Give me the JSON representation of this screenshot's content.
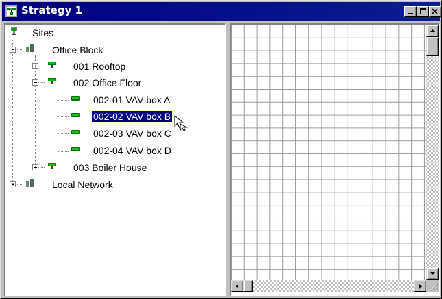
{
  "window": {
    "title": "Strategy 1",
    "icon": "strategy-window-icon",
    "controls": [
      "minimize-icon",
      "maximize-icon",
      "close-icon"
    ]
  },
  "tree": {
    "root": {
      "label": "Sites",
      "icon": "sites-icon"
    },
    "office_block": {
      "label": "Office Block",
      "icon": "site-building-icon",
      "expanded": true
    },
    "rooftop": {
      "label": "001 Rooftop",
      "icon": "device-icon",
      "expanded": false
    },
    "office_floor": {
      "label": "002 Office Floor",
      "icon": "device-icon",
      "expanded": true
    },
    "vav_a": {
      "label": "002-01 VAV box A",
      "icon": "vav-module-icon"
    },
    "vav_b": {
      "label": "002-02 VAV box B",
      "icon": "vav-module-icon",
      "selected": true
    },
    "vav_c": {
      "label": "002-03 VAV box C",
      "icon": "vav-module-icon"
    },
    "vav_d": {
      "label": "002-04 VAV box D",
      "icon": "vav-module-icon"
    },
    "boiler_house": {
      "label": "003 Boiler House",
      "icon": "device-icon",
      "expanded": false
    },
    "local_network": {
      "label": "Local Network",
      "icon": "site-building-icon",
      "expanded": false
    }
  },
  "colors": {
    "titlebar": "#000080",
    "selection": "#000080",
    "face": "#c0c0c0",
    "grid_line": "#9a9a9a"
  }
}
